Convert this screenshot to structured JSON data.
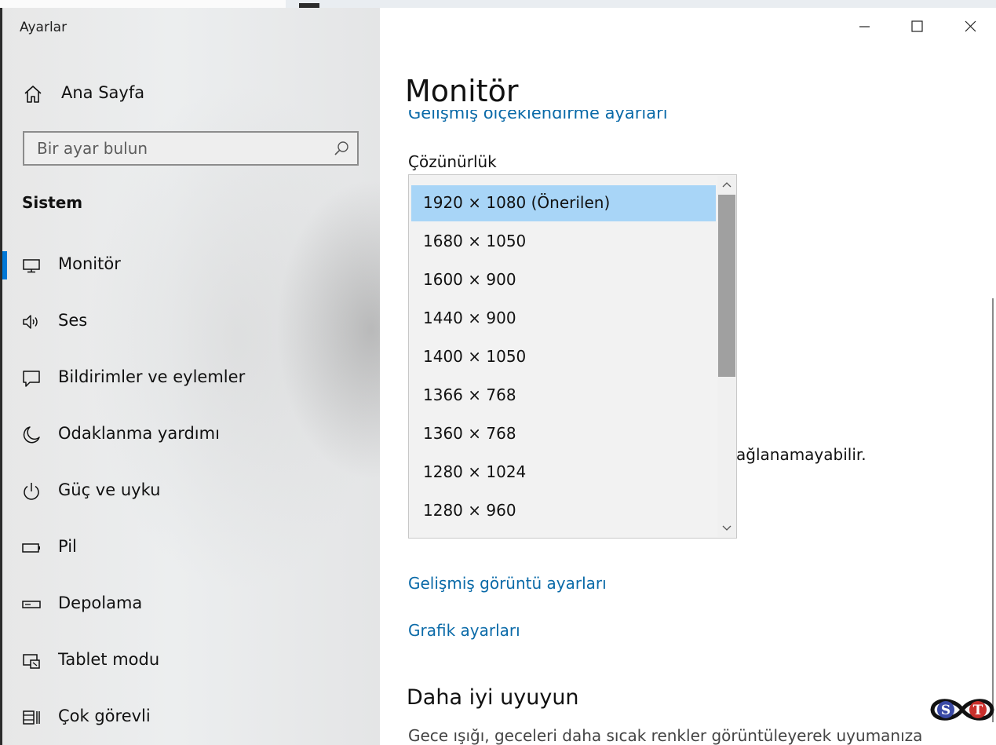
{
  "window": {
    "title": "Ayarlar"
  },
  "sidebar": {
    "home_label": "Ana Sayfa",
    "search_placeholder": "Bir ayar bulun",
    "section": "Sistem",
    "items": [
      {
        "label": "Monitör",
        "icon": "monitor-icon",
        "selected": true
      },
      {
        "label": "Ses",
        "icon": "speaker-icon"
      },
      {
        "label": "Bildirimler ve eylemler",
        "icon": "notification-icon"
      },
      {
        "label": "Odaklanma yardımı",
        "icon": "moon-icon"
      },
      {
        "label": "Güç ve uyku",
        "icon": "power-icon"
      },
      {
        "label": "Pil",
        "icon": "battery-icon"
      },
      {
        "label": "Depolama",
        "icon": "storage-icon"
      },
      {
        "label": "Tablet modu",
        "icon": "tablet-mode-icon"
      },
      {
        "label": "Çok görevli",
        "icon": "multitasking-icon"
      }
    ]
  },
  "main": {
    "title": "Monitör",
    "clipped_link": "Gelişmiş ölçeklendirme ayarları",
    "resolution_label": "Çözünürlük",
    "resolution_options": [
      "1920 × 1080 (Önerilen)",
      "1680 × 1050",
      "1600 × 900",
      "1440 × 900",
      "1400 × 1050",
      "1366 × 768",
      "1360 × 768",
      "1280 × 1024",
      "1280 × 960"
    ],
    "selected_resolution": "1920 × 1080 (Önerilen)",
    "partial_text": "ağlanamayabilir.",
    "links": [
      "Gelişmiş görüntü ayarları",
      "Grafik ayarları"
    ],
    "sleep_title": "Daha iyi uyuyun",
    "sleep_desc": "Gece ışığı, geceleri daha sıcak renkler görüntüleyerek uyumanıza"
  },
  "colors": {
    "accent": "#0078d7",
    "link": "#0a6aa8",
    "selected_item": "#a8d5f7"
  },
  "logo": {
    "letters": [
      "S",
      "T"
    ]
  }
}
